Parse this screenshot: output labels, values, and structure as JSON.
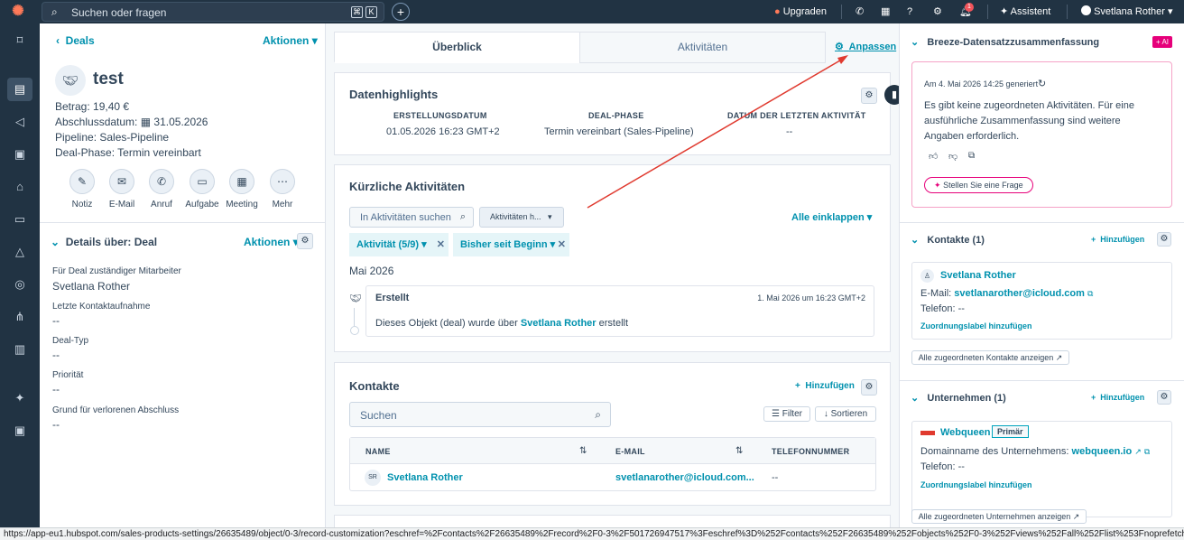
{
  "topbar": {
    "search_placeholder": "Suchen oder fragen",
    "kbd1": "⌘",
    "kbd2": "K",
    "upgrade": "Upgraden",
    "notif_count": "1",
    "assistant": "Assistent",
    "user": "Svetlana Rother"
  },
  "record": {
    "back_label": "Deals",
    "actions": "Aktionen",
    "title": "test",
    "amount_label": "Betrag:",
    "amount_value": "19,40 €",
    "close_label": "Abschlussdatum:",
    "close_value": "31.05.2026",
    "pipeline_label": "Pipeline:",
    "pipeline_value": "Sales-Pipeline",
    "phase_label": "Deal-Phase:",
    "phase_value": "Termin vereinbart",
    "action_buttons": [
      "Notiz",
      "E-Mail",
      "Anruf",
      "Aufgabe",
      "Meeting",
      "Mehr"
    ]
  },
  "details": {
    "title": "Details über: Deal",
    "actions": "Aktionen",
    "fields": [
      {
        "label": "Für Deal zuständiger Mitarbeiter",
        "value": "Svetlana Rother"
      },
      {
        "label": "Letzte Kontaktaufnahme",
        "value": "--"
      },
      {
        "label": "Deal-Typ",
        "value": "--"
      },
      {
        "label": "Priorität",
        "value": "--"
      },
      {
        "label": "Grund für verlorenen Abschluss",
        "value": "--"
      }
    ]
  },
  "tabs": {
    "overview": "Überblick",
    "activities": "Aktivitäten",
    "customize": "Anpassen"
  },
  "highlights": {
    "title": "Datenhighlights",
    "cols": [
      {
        "head": "ERSTELLUNGSDATUM",
        "value": "01.05.2026 16:23 GMT+2"
      },
      {
        "head": "DEAL-PHASE",
        "value": "Termin vereinbart (Sales-Pipeline)"
      },
      {
        "head": "DATUM DER LETZTEN AKTIVITÄT",
        "value": "--"
      }
    ]
  },
  "recent": {
    "title": "Kürzliche Aktivitäten",
    "search_placeholder": "In Aktivitäten suchen",
    "filter_dropdown": "Aktivitäten h...",
    "collapse_all": "Alle einklappen",
    "chip1": "Aktivität (5/9)",
    "chip2": "Bisher seit Beginn",
    "month": "Mai 2026",
    "item_title": "Erstellt",
    "item_date": "1. Mai 2026 um 16:23 GMT+2",
    "item_text_pre": "Dieses Objekt (deal) wurde über",
    "item_link": "Svetlana Rother",
    "item_text_post": "erstellt"
  },
  "contacts_mid": {
    "title": "Kontakte",
    "add": "Hinzufügen",
    "search_placeholder": "Suchen",
    "filter": "Filter",
    "sort": "Sortieren",
    "headers": [
      "NAME",
      "E-MAIL",
      "TELEFONNUMMER"
    ],
    "rows": [
      {
        "initials": "SR",
        "name": "Svetlana Rother",
        "email": "svetlanarother@icloud.com...",
        "phone": "--"
      }
    ]
  },
  "breeze": {
    "title": "Breeze-Datensatzzusammenfassung",
    "ai_badge": "+ AI",
    "generated": "Am 4. Mai 2026 14:25 generiert",
    "summary": "Es gibt keine zugeordneten Aktivitäten. Für eine ausführliche Zusammenfassung sind weitere Angaben erforderlich.",
    "ask": "Stellen Sie eine Frage"
  },
  "contacts_right": {
    "title": "Kontakte (1)",
    "add": "Hinzufügen",
    "name": "Svetlana Rother",
    "email_label": "E-Mail:",
    "email_value": "svetlanarother@icloud.com",
    "phone_label": "Telefon:",
    "phone_value": "--",
    "assoc_label": "Zuordnungslabel hinzufügen",
    "show_all": "Alle zugeordneten Kontakte anzeigen"
  },
  "companies_right": {
    "title": "Unternehmen (1)",
    "add": "Hinzufügen",
    "name": "Webqueen",
    "primary": "Primär",
    "domain_label": "Domainname des Unternehmens:",
    "domain_value": "webqueen.io",
    "phone_label": "Telefon:",
    "phone_value": "--",
    "assoc_label": "Zuordnungslabel hinzufügen",
    "show_all": "Alle zugeordneten Unternehmen anzeigen"
  },
  "statusbar": {
    "url": "https://app-eu1.hubspot.com/sales-products-settings/26635489/object/0-3/record-customization?eschref=%2Fcontacts%2F26635489%2Frecord%2F0-3%2F501726947517%3Feschref%3D%252Fcontacts%252F26635489%252Fobjects%252F0-3%252Fviews%252Fall%252Flist%253Fnoprefetch%253D%26initialCardsRe..."
  },
  "colors": {
    "accent": "#0091ae",
    "topbar": "#213343",
    "arrow": "#e03a2f"
  }
}
